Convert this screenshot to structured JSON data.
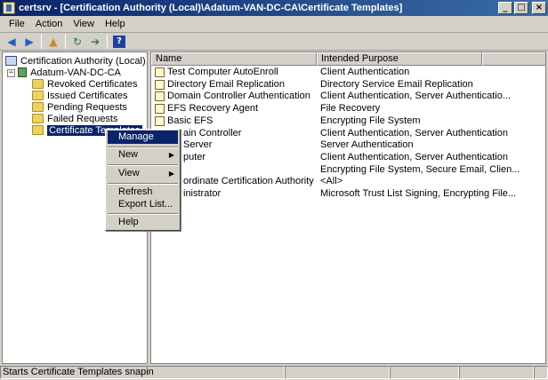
{
  "window": {
    "title": "certsrv - [Certification Authority (Local)\\Adatum-VAN-DC-CA\\Certificate Templates]",
    "buttons": {
      "minimize": "_",
      "maximize": "□",
      "close": "×"
    }
  },
  "menubar": {
    "items": [
      "File",
      "Action",
      "View",
      "Help"
    ]
  },
  "toolbar": {
    "buttons": [
      {
        "icon": "back-arrow-icon",
        "glyph": "◀"
      },
      {
        "icon": "forward-arrow-icon",
        "glyph": "▶"
      },
      {
        "icon": "up-folder-icon",
        "glyph": "▲"
      },
      {
        "icon": "refresh-icon",
        "glyph": "↻"
      },
      {
        "icon": "export-list-icon",
        "glyph": "➔"
      },
      {
        "icon": "help-icon",
        "glyph": "?"
      }
    ]
  },
  "tree": {
    "root": "Certification Authority (Local)",
    "ca": "Adatum-VAN-DC-CA",
    "folders": [
      "Revoked Certificates",
      "Issued Certificates",
      "Pending Requests",
      "Failed Requests",
      "Certificate Templates"
    ],
    "expander_glyph": "−"
  },
  "list": {
    "columns": [
      "Name",
      "Intended Purpose"
    ],
    "rows": [
      {
        "name": "Test Computer AutoEnroll",
        "purpose": "Client Authentication"
      },
      {
        "name": "Directory Email Replication",
        "purpose": "Directory Service Email Replication"
      },
      {
        "name": "Domain Controller Authentication",
        "purpose": "Client Authentication, Server Authenticatio..."
      },
      {
        "name": "EFS Recovery Agent",
        "purpose": "File Recovery"
      },
      {
        "name": "Basic EFS",
        "purpose": "Encrypting File System"
      },
      {
        "name": "ain Controller",
        "purpose": "Client Authentication, Server Authentication"
      },
      {
        "name": "Server",
        "purpose": "Server Authentication"
      },
      {
        "name": "puter",
        "purpose": "Client Authentication, Server Authentication"
      },
      {
        "name": "",
        "purpose": "Encrypting File System, Secure Email, Clien..."
      },
      {
        "name": "ordinate Certification Authority",
        "purpose": "<All>"
      },
      {
        "name": "inistrator",
        "purpose": "Microsoft Trust List Signing, Encrypting File..."
      }
    ]
  },
  "context_menu": {
    "items": [
      "Manage",
      "New",
      "View",
      "Refresh",
      "Export List...",
      "Help"
    ],
    "submenu_arrow": "▶"
  },
  "statusbar": {
    "text": "Starts Certificate Templates snapin"
  },
  "colors": {
    "titlebar": "#0a246a",
    "selection": "#0a246a",
    "chrome": "#d4d0c8"
  }
}
